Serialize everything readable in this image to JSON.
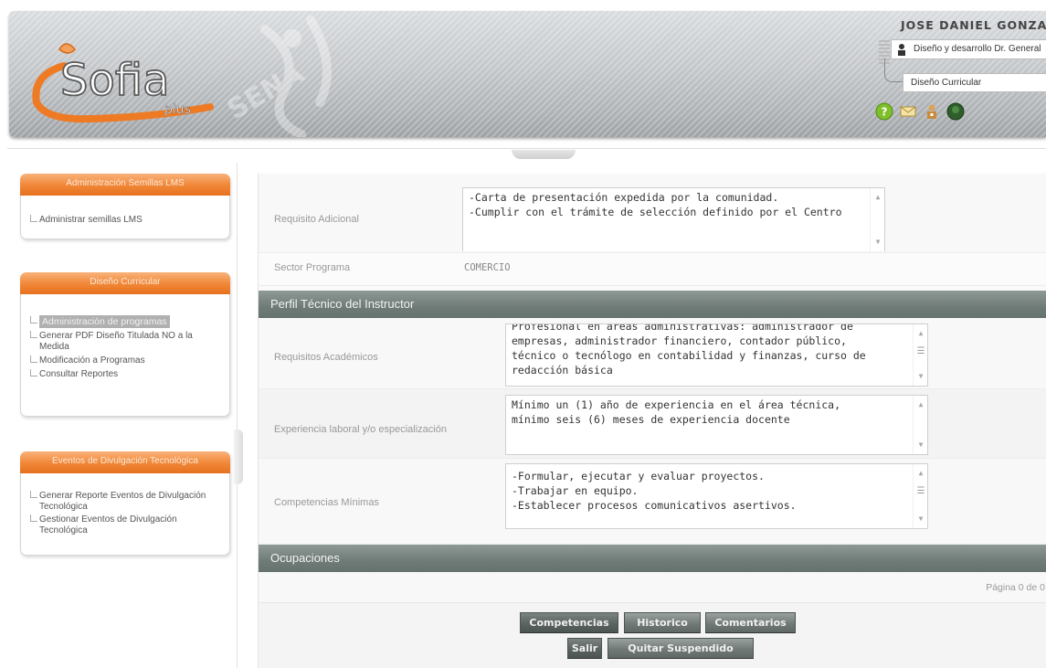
{
  "header": {
    "logo_text": "Sofia",
    "logo_subtext": "plus",
    "watermark_text": "SENA",
    "user_name": "JOSE DANIEL GONZALEZ",
    "role": "Diseño y desarrollo Dr. General",
    "module": "Diseño Curricular",
    "icons": [
      "help-icon",
      "mail-icon",
      "user-lock-icon",
      "power-icon"
    ]
  },
  "sidebar": {
    "sections": [
      {
        "title": "Administración Semillas LMS",
        "items": [
          {
            "label": "Administrar semillas LMS",
            "active": false
          }
        ]
      },
      {
        "title": "Diseño Curricular",
        "items": [
          {
            "label": "Administración de programas",
            "active": true
          },
          {
            "label": "Generar PDF Diseño Titulada NO a la Medida",
            "active": false
          },
          {
            "label": "Modificación a Programas",
            "active": false
          },
          {
            "label": "Consultar Reportes",
            "active": false
          }
        ]
      },
      {
        "title": "Eventos de Divulgación Tecnológica",
        "items": [
          {
            "label": "Generar Reporte Eventos de Divulgación Tecnológica",
            "active": false
          },
          {
            "label": "Gestionar Eventos de Divulgación Tecnológica",
            "active": false
          }
        ]
      }
    ]
  },
  "form": {
    "requisito_adicional": {
      "label": "Requisito Adicional",
      "lines": [
        "-Carta de presentación expedida por la comunidad.",
        "-Cumplir con el trámite de selección definido por el Centro"
      ]
    },
    "sector_programa": {
      "label": "Sector Programa",
      "value": "COMERCIO"
    },
    "perfil_section": "Perfil Técnico del Instructor",
    "requisitos_academicos": {
      "label": "Requisitos Académicos",
      "lines": [
        "Profesional en áreas administrativas: administrador de",
        "empresas, administrador financiero, contador público,",
        "técnico o tecnólogo en contabilidad y finanzas, curso de",
        "redacción básica"
      ]
    },
    "experiencia": {
      "label": "Experiencia laboral y/o especialización",
      "lines": [
        "Mínimo un (1) año de experiencia en  el área técnica,",
        "mínimo seis (6) meses de experiencia docente"
      ]
    },
    "competencias_minimas": {
      "label": "Competencias Mínimas",
      "lines": [
        "-Formular, ejecutar y evaluar proyectos.",
        "-Trabajar en equipo.",
        "-Establecer procesos comunicativos asertivos."
      ]
    },
    "ocupaciones_section": "Ocupaciones",
    "pagination": "Página 0 de 0"
  },
  "buttons": {
    "competencias": "Competencias",
    "historico": "Historico",
    "comentarios": "Comentarios",
    "salir": "Salir",
    "quitar_suspendido": "Quitar Suspendido"
  },
  "colors": {
    "orange_header": "#f08636",
    "section_bar": "#6f7b77",
    "button": "#717a77"
  }
}
